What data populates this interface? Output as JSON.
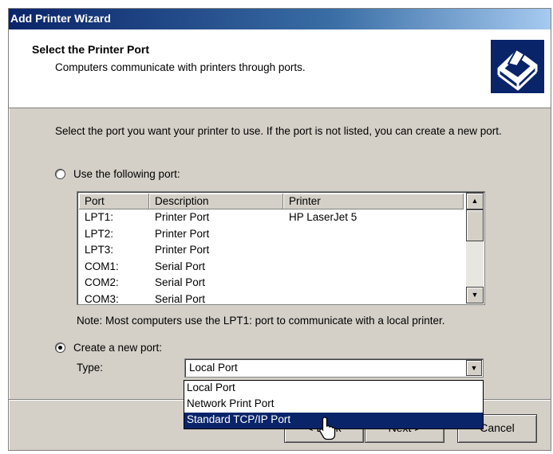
{
  "window": {
    "title": "Add Printer Wizard"
  },
  "header": {
    "title": "Select the Printer Port",
    "subtitle": "Computers communicate with printers through ports."
  },
  "intro_text": "Select the port you want your printer to use.  If the port is not listed, you can create a new port.",
  "use_port_option": {
    "label": "Use the following port:",
    "checked": false
  },
  "port_list": {
    "columns": [
      "Port",
      "Description",
      "Printer"
    ],
    "rows": [
      [
        "LPT1:",
        "Printer Port",
        "HP LaserJet 5"
      ],
      [
        "LPT2:",
        "Printer Port",
        ""
      ],
      [
        "LPT3:",
        "Printer Port",
        ""
      ],
      [
        "COM1:",
        "Serial Port",
        ""
      ],
      [
        "COM2:",
        "Serial Port",
        ""
      ],
      [
        "COM3:",
        "Serial Port",
        ""
      ]
    ]
  },
  "note": "Note: Most computers use the LPT1: port to communicate with a local printer.",
  "create_port_option": {
    "label": "Create a new port:",
    "checked": true
  },
  "type_field": {
    "label": "Type:",
    "value": "Local Port",
    "options": [
      "Local Port",
      "Network Print Port",
      "Standard TCP/IP Port"
    ],
    "highlighted": "Standard TCP/IP Port"
  },
  "buttons": {
    "back": "< Back",
    "next": "Next >",
    "cancel": "Cancel"
  },
  "icons": {
    "header": "printer-icon",
    "cursor": "mouse-pointer-icon"
  },
  "colors": {
    "title_bar": "#0a246a",
    "highlight": "#0a246a",
    "face": "#d4d0c8"
  }
}
